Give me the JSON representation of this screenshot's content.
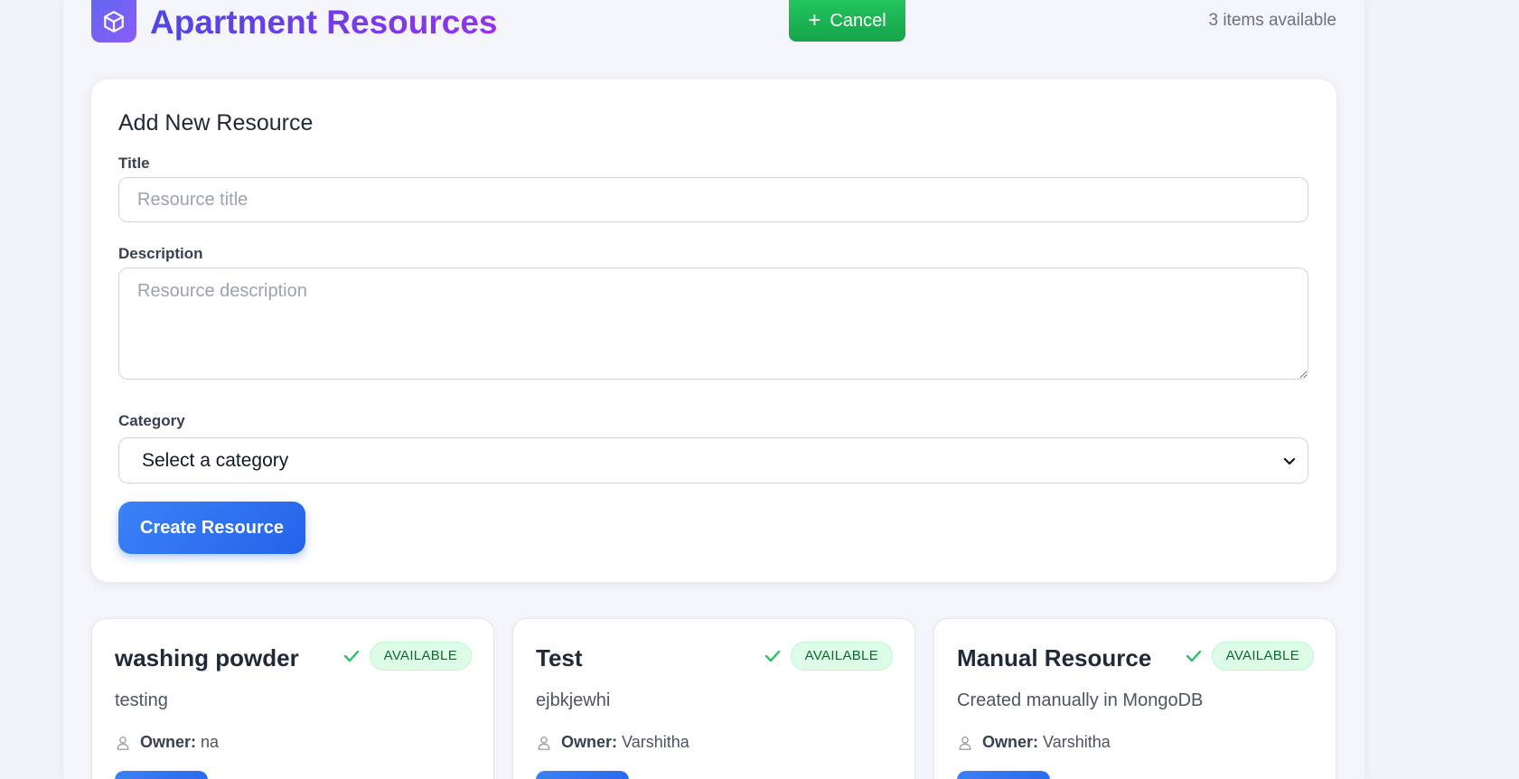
{
  "header": {
    "logo_icon": "cube-icon",
    "title": "Apartment Resources",
    "cancel_label": "Cancel",
    "cancel_icon": "plus-icon",
    "items_count": "3 items available"
  },
  "form": {
    "heading": "Add New Resource",
    "title_label": "Title",
    "title_placeholder": "Resource title",
    "title_value": "",
    "description_label": "Description",
    "description_placeholder": "Resource description",
    "description_value": "",
    "category_label": "Category",
    "category_selected": "Select a category",
    "submit_label": "Create Resource"
  },
  "resources": [
    {
      "title": "washing powder",
      "status": "AVAILABLE",
      "description": "testing",
      "owner_label": "Owner:",
      "owner": "na"
    },
    {
      "title": "Test",
      "status": "AVAILABLE",
      "description": "ejbkjewhi",
      "owner_label": "Owner:",
      "owner": "Varshitha"
    },
    {
      "title": "Manual Resource",
      "status": "AVAILABLE",
      "description": "Created manually in MongoDB",
      "owner_label": "Owner:",
      "owner": "Varshitha"
    }
  ],
  "colors": {
    "accent_primary": "#2563eb",
    "accent_success": "#16a34a",
    "brand_gradient_start": "#4f46e5",
    "brand_gradient_end": "#9333ea",
    "badge_bg": "#dcfce7",
    "badge_text": "#166534"
  }
}
